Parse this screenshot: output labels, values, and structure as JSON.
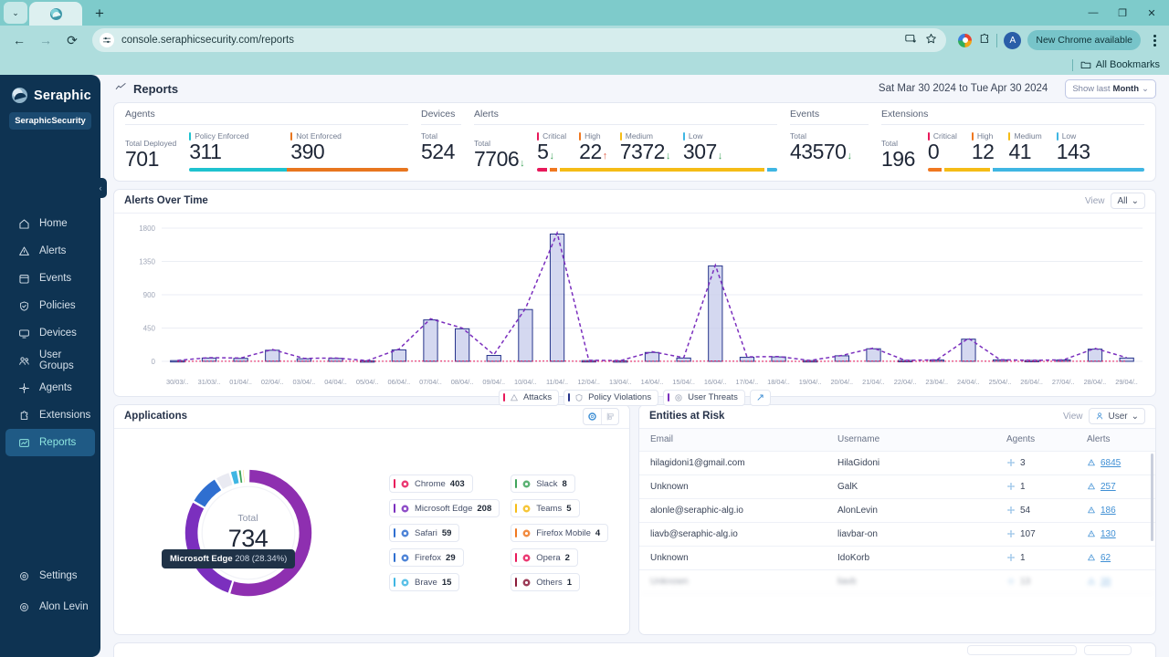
{
  "browser": {
    "tab_title": "Seraphic",
    "url": "console.seraphicsecurity.com/reports",
    "new_chrome_label": "New Chrome available",
    "avatar_letter": "A",
    "bookmarks_label": "All Bookmarks",
    "nav_back": "←",
    "nav_forward": "→",
    "nav_reload": "⟳",
    "minimize": "—",
    "maximize": "❐",
    "close": "✕",
    "newtab": "+",
    "tablist": "⌄"
  },
  "sidebar": {
    "brand": "Seraphic",
    "tenant": "SeraphicSecurity",
    "collapse_glyph": "‹",
    "items": [
      {
        "label": "Home",
        "icon": "home-icon",
        "active": false
      },
      {
        "label": "Alerts",
        "icon": "alert-triangle-icon",
        "active": false
      },
      {
        "label": "Events",
        "icon": "calendar-icon",
        "active": false
      },
      {
        "label": "Policies",
        "icon": "shield-check-icon",
        "active": false
      },
      {
        "label": "Devices",
        "icon": "monitor-icon",
        "active": false
      },
      {
        "label": "User Groups",
        "icon": "users-icon",
        "active": false
      },
      {
        "label": "Agents",
        "icon": "agents-icon",
        "active": false
      },
      {
        "label": "Extensions",
        "icon": "puzzle-icon",
        "active": false
      },
      {
        "label": "Reports",
        "icon": "report-icon",
        "active": true
      }
    ],
    "bottom_items": [
      {
        "label": "Settings",
        "icon": "gear-icon"
      },
      {
        "label": "Alon Levin",
        "icon": "user-circle-icon"
      }
    ]
  },
  "header": {
    "title": "Reports",
    "date_range": "Sat Mar 30 2024 to Tue Apr 30 2024",
    "show_last_prefix": "Show last",
    "show_last_value": "Month",
    "chevron": "⌄"
  },
  "kpis": {
    "agents": {
      "title": "Agents",
      "cells": [
        {
          "label": "Total Deployed",
          "value": "701",
          "tick": ""
        },
        {
          "label": "Policy Enforced",
          "value": "311",
          "tick": "#1fc2cf"
        },
        {
          "label": "Not Enforced",
          "value": "390",
          "tick": "#e8761f"
        }
      ],
      "bar": [
        {
          "color": "#1fc2cf",
          "pct": 44.4
        },
        {
          "color": "#e8761f",
          "pct": 55.6
        }
      ]
    },
    "devices": {
      "title": "Devices",
      "cells": [
        {
          "label": "Total",
          "value": "524",
          "tick": ""
        }
      ]
    },
    "alerts": {
      "title": "Alerts",
      "cells": [
        {
          "label": "Total",
          "value": "7706",
          "trend": "down",
          "tick": ""
        },
        {
          "label": "Critical",
          "value": "5",
          "trend": "down",
          "tick": "#e8185a"
        },
        {
          "label": "High",
          "value": "22",
          "trend": "up",
          "tick": "#f07820"
        },
        {
          "label": "Medium",
          "value": "7372",
          "trend": "down",
          "tick": "#f5bc16"
        },
        {
          "label": "Low",
          "value": "307",
          "trend": "down",
          "tick": "#3fb6e3"
        }
      ],
      "bar": [
        {
          "color": "#e8185a",
          "pct": 4.0
        },
        {
          "color": "#f07820",
          "pct": 3.2
        },
        {
          "color": "#f5bc16",
          "pct": 87.0
        },
        {
          "color": "#3fb6e3",
          "pct": 5.8
        }
      ]
    },
    "events": {
      "title": "Events",
      "cells": [
        {
          "label": "Total",
          "value": "43570",
          "trend": "down",
          "tick": ""
        }
      ]
    },
    "extensions": {
      "title": "Extensions",
      "cells": [
        {
          "label": "Total",
          "value": "196",
          "tick": ""
        },
        {
          "label": "Critical",
          "value": "0",
          "tick": "#e8185a"
        },
        {
          "label": "High",
          "value": "12",
          "tick": "#f07820"
        },
        {
          "label": "Medium",
          "value": "41",
          "tick": "#f5bc16"
        },
        {
          "label": "Low",
          "value": "143",
          "tick": "#3fb6e3"
        }
      ],
      "bar": [
        {
          "color": "#f07820",
          "pct": 6.2
        },
        {
          "color": "#f5bc16",
          "pct": 21.0
        },
        {
          "color": "#3fb6e3",
          "pct": 72.8
        }
      ]
    },
    "trend_up_glyph": "↑",
    "trend_down_glyph": "↓"
  },
  "alerts_chart_panel": {
    "title": "Alerts Over Time",
    "view_label": "View",
    "view_value": "All",
    "chevron": "⌄",
    "legend": [
      {
        "label": "Attacks",
        "color": "#e8185a",
        "icon": "attack-icon"
      },
      {
        "label": "Policy Violations",
        "color": "#27348b",
        "icon": "policy-icon"
      },
      {
        "label": "User Threats",
        "color": "#7b2fbe",
        "icon": "user-threat-icon"
      }
    ],
    "expand_glyph": "↗"
  },
  "chart_data": {
    "type": "bar",
    "title": "Alerts Over Time",
    "xlabel": "",
    "ylabel": "",
    "ylim": [
      0,
      1800
    ],
    "yticks": [
      0,
      450,
      900,
      1350,
      1800
    ],
    "grid": true,
    "legend_position": "bottom",
    "categories": [
      "30/03/..",
      "31/03/..",
      "01/04/..",
      "02/04/..",
      "03/04/..",
      "04/04/..",
      "05/04/..",
      "06/04/..",
      "07/04/..",
      "08/04/..",
      "09/04/..",
      "10/04/..",
      "11/04/..",
      "12/04/..",
      "13/04/..",
      "14/04/..",
      "15/04/..",
      "16/04/..",
      "17/04/..",
      "18/04/..",
      "19/04/..",
      "20/04/..",
      "21/04/..",
      "22/04/..",
      "23/04/..",
      "24/04/..",
      "25/04/..",
      "26/04/..",
      "27/04/..",
      "28/04/..",
      "29/04/.."
    ],
    "series": [
      {
        "name": "Policy Violations",
        "color": "#27348b",
        "type": "bar",
        "values": [
          10,
          45,
          40,
          150,
          35,
          40,
          8,
          155,
          560,
          440,
          80,
          700,
          1720,
          10,
          8,
          120,
          45,
          1290,
          55,
          60,
          10,
          75,
          170,
          12,
          18,
          300,
          20,
          12,
          18,
          165,
          45
        ]
      },
      {
        "name": "User Threats",
        "color": "#7b2fbe",
        "type": "line-dashed",
        "values": [
          12,
          50,
          45,
          160,
          40,
          45,
          10,
          165,
          575,
          450,
          90,
          715,
          1735,
          15,
          10,
          130,
          50,
          1300,
          60,
          65,
          12,
          80,
          180,
          14,
          20,
          312,
          22,
          14,
          20,
          175,
          50
        ]
      },
      {
        "name": "Attacks",
        "color": "#e8185a",
        "type": "line-dotted",
        "values": [
          0,
          2,
          1,
          3,
          1,
          2,
          0,
          3,
          4,
          3,
          1,
          3,
          5,
          0,
          0,
          2,
          1,
          4,
          1,
          1,
          0,
          2,
          3,
          0,
          1,
          4,
          1,
          0,
          1,
          3,
          1
        ]
      }
    ]
  },
  "applications": {
    "title": "Applications",
    "donut_total_label": "Total",
    "donut_total_value": "734",
    "tooltip_name": "Microsoft Edge",
    "tooltip_value": "208",
    "tooltip_pct": "(28.34%)",
    "toggle_donut_icon": "donut-chart-icon",
    "toggle_bar_icon": "bar-chart-icon",
    "items": [
      {
        "name": "Chrome",
        "value": "403",
        "tick": "#e8185a",
        "icon": "chrome-icon"
      },
      {
        "name": "Slack",
        "value": "8",
        "tick": "#3fa45c",
        "icon": "slack-icon"
      },
      {
        "name": "Microsoft Edge",
        "value": "208",
        "tick": "#7b2fbe",
        "icon": "edge-icon"
      },
      {
        "name": "Teams",
        "value": "5",
        "tick": "#f5bc16",
        "icon": "teams-icon"
      },
      {
        "name": "Safari",
        "value": "59",
        "tick": "#2f6fd0",
        "icon": "safari-icon"
      },
      {
        "name": "Firefox Mobile",
        "value": "4",
        "tick": "#f07820",
        "icon": "firefox-mobile-icon"
      },
      {
        "name": "Firefox",
        "value": "29",
        "tick": "#2f6fd0",
        "icon": "firefox-icon"
      },
      {
        "name": "Opera",
        "value": "2",
        "tick": "#e8185a",
        "icon": "opera-icon"
      },
      {
        "name": "Brave",
        "value": "15",
        "tick": "#3fb6e3",
        "icon": "brave-icon"
      },
      {
        "name": "Others",
        "value": "1",
        "tick": "#8b1a3a",
        "icon": "others-icon"
      }
    ],
    "donut_segments": [
      {
        "name": "Chrome",
        "value": 403,
        "color": "#8e2fb0"
      },
      {
        "name": "Microsoft Edge",
        "value": 208,
        "color": "#7b2fbe"
      },
      {
        "name": "Safari",
        "value": 59,
        "color": "#2f6fd0"
      },
      {
        "name": "Firefox",
        "value": 29,
        "color": "#e9eaf2"
      },
      {
        "name": "Brave",
        "value": 15,
        "color": "#3fb6e3"
      },
      {
        "name": "Slack",
        "value": 8,
        "color": "#3fa45c"
      },
      {
        "name": "Teams",
        "value": 5,
        "color": "#f5bc16"
      },
      {
        "name": "Firefox Mobile",
        "value": 4,
        "color": "#f07820"
      },
      {
        "name": "Opera",
        "value": 2,
        "color": "#e8185a"
      },
      {
        "name": "Others",
        "value": 1,
        "color": "#8b1a3a"
      }
    ]
  },
  "entities": {
    "title": "Entities at Risk",
    "view_label": "View",
    "view_value": "User",
    "chevron": "⌄",
    "columns": [
      "Email",
      "Username",
      "Agents",
      "Alerts"
    ],
    "rows": [
      {
        "email": "hilagidoni1@gmail.com",
        "username": "HilaGidoni",
        "agents": "3",
        "alerts": "6845"
      },
      {
        "email": "Unknown",
        "username": "GalK",
        "agents": "1",
        "alerts": "257"
      },
      {
        "email": "alonle@seraphic-alg.io",
        "username": "AlonLevin",
        "agents": "54",
        "alerts": "186"
      },
      {
        "email": "liavb@seraphic-alg.io",
        "username": "liavbar-on",
        "agents": "107",
        "alerts": "130"
      },
      {
        "email": "Unknown",
        "username": "IdoKorb",
        "agents": "1",
        "alerts": "62"
      },
      {
        "email": "Unknown",
        "username": "liavb",
        "agents": "13",
        "alerts": "39"
      }
    ]
  }
}
